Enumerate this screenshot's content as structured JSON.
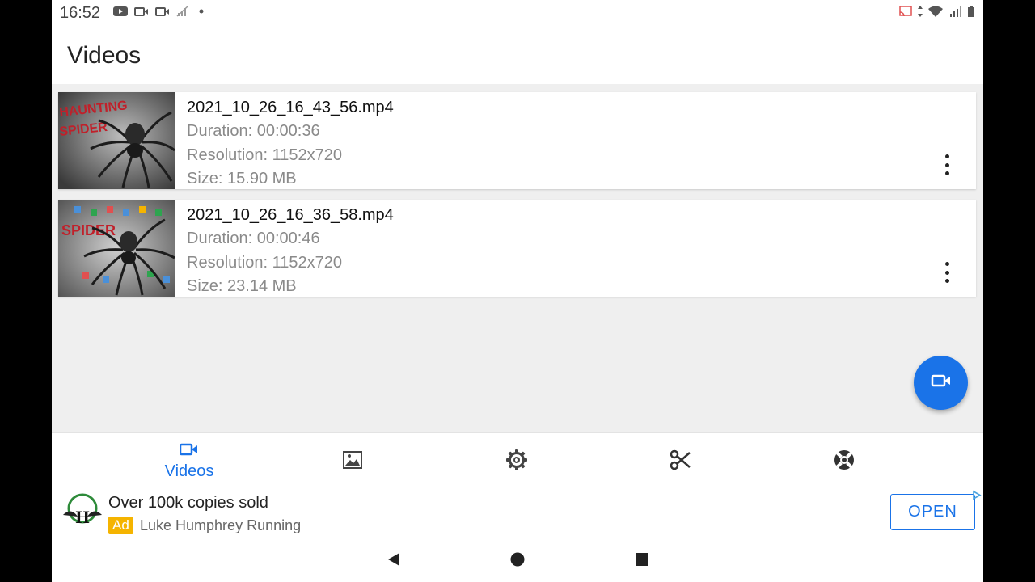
{
  "status_bar": {
    "time": "16:52",
    "left_icons": [
      "youtube-icon",
      "video-icon",
      "video-icon",
      "signal-off-icon",
      "dot-icon"
    ],
    "right_icons": [
      "cast-icon",
      "data-arrows-icon",
      "wifi-icon",
      "signal-3g-icon",
      "battery-icon"
    ]
  },
  "app_bar": {
    "title": "Videos"
  },
  "videos": [
    {
      "name": "2021_10_26_16_43_56.mp4",
      "duration": "Duration: 00:00:36",
      "resolution": "Resolution: 1152x720",
      "size": "Size: 15.90 MB",
      "thumbnail_text": "HAUNTING SPIDER"
    },
    {
      "name": "2021_10_26_16_36_58.mp4",
      "duration": "Duration: 00:00:46",
      "resolution": "Resolution: 1152x720",
      "size": "Size: 23.14 MB",
      "thumbnail_text": "SPIDER"
    }
  ],
  "bottom_nav": {
    "items": [
      {
        "icon": "video-camera-icon",
        "label": "Videos",
        "active": true
      },
      {
        "icon": "image-icon",
        "label": "",
        "active": false
      },
      {
        "icon": "settings-gear-icon",
        "label": "",
        "active": false
      },
      {
        "icon": "scissors-icon",
        "label": "",
        "active": false
      },
      {
        "icon": "lifebuoy-icon",
        "label": "",
        "active": false
      }
    ]
  },
  "ad": {
    "title": "Over 100k copies sold",
    "badge": "Ad",
    "advertiser": "Luke Humphrey Running",
    "cta": "OPEN",
    "logo_letter": "H"
  },
  "colors": {
    "accent": "#1a73e8",
    "ad_badge": "#f5b400",
    "background": "#efefef"
  }
}
